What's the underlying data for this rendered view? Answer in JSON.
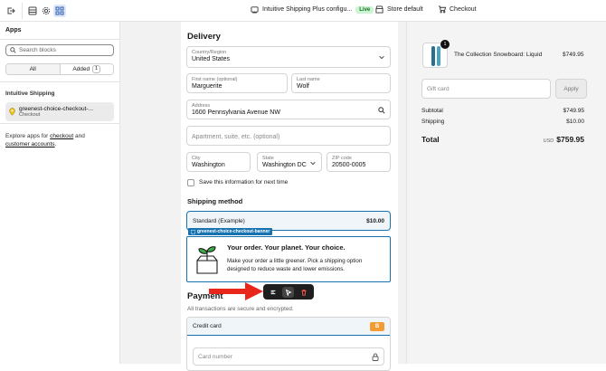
{
  "topbar": {
    "app_config_label": "Intuitive Shipping Plus configu...",
    "live_badge": "Live",
    "store_label": "Store default",
    "checkout_label": "Checkout"
  },
  "sidebar": {
    "title": "Apps",
    "search_placeholder": "Search blocks",
    "tabs": [
      {
        "label": "All"
      },
      {
        "label": "Added",
        "count": "1"
      }
    ],
    "section_title": "Intuitive Shipping",
    "block": {
      "name": "greenest-choice-checkout-...",
      "location": "Checkout"
    },
    "explore_prefix": "Explore apps for ",
    "explore_link1": "checkout",
    "explore_mid": " and",
    "explore_link2": "customer accounts",
    "explore_suffix": "."
  },
  "delivery": {
    "heading": "Delivery",
    "country": {
      "label": "Country/Region",
      "value": "United States"
    },
    "first_name": {
      "label": "First name (optional)",
      "value": "Marguerite"
    },
    "last_name": {
      "label": "Last name",
      "value": "Wolf"
    },
    "address": {
      "label": "Address",
      "value": "1600 Pennsylvania Avenue NW"
    },
    "apartment": {
      "placeholder": "Apartment, suite, etc. (optional)"
    },
    "city": {
      "label": "City",
      "value": "Washington"
    },
    "state": {
      "label": "State",
      "value": "Washington DC"
    },
    "zip": {
      "label": "ZIP code",
      "value": "20500-0005"
    },
    "save_info": "Save this information for next time"
  },
  "shipping": {
    "heading": "Shipping method",
    "option_name": "Standard (Example)",
    "option_price": "$10.00"
  },
  "banner": {
    "tag": "greenest-choice-checkout-banner",
    "title": "Your order. Your planet. Your choice.",
    "description": "Make your order a little greener. Pick a shipping option designed to reduce waste and lower emissions."
  },
  "payment": {
    "heading": "Payment",
    "subtext": "All transactions are secure and encrypted.",
    "method": "Credit card",
    "method_badge": "B",
    "card_placeholder": "Card number"
  },
  "summary": {
    "quantity": "1",
    "product_name": "The Collection Snowboard: Liquid",
    "product_price": "$749.95",
    "gift_placeholder": "Gift card",
    "apply_label": "Apply",
    "subtotal_label": "Subtotal",
    "subtotal_value": "$749.95",
    "shipping_label": "Shipping",
    "shipping_value": "$10.00",
    "total_label": "Total",
    "total_currency": "USD",
    "total_value": "$759.95"
  },
  "colors": {
    "accent": "#1773b0",
    "live_bg": "#c9f5d0",
    "annotation_arrow": "#e8261c",
    "toolbar_bg": "#1f1f1f"
  }
}
